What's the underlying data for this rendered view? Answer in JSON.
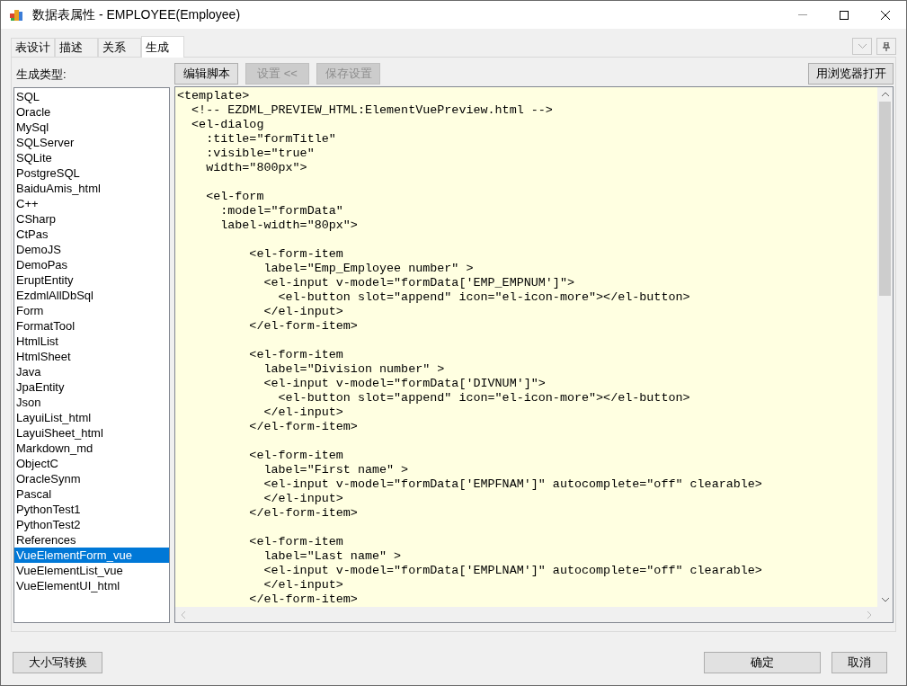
{
  "window": {
    "title": "数据表属性 - EMPLOYEE(Employee)"
  },
  "tabs": [
    {
      "label": "表设计",
      "selected": false
    },
    {
      "label": "描述",
      "selected": false
    },
    {
      "label": "关系",
      "selected": false
    },
    {
      "label": "生成",
      "selected": true
    }
  ],
  "sidebar": {
    "label": "生成类型:",
    "items": [
      {
        "label": "SQL",
        "selected": false
      },
      {
        "label": "Oracle",
        "selected": false
      },
      {
        "label": "MySql",
        "selected": false
      },
      {
        "label": "SQLServer",
        "selected": false
      },
      {
        "label": "SQLite",
        "selected": false
      },
      {
        "label": "PostgreSQL",
        "selected": false
      },
      {
        "label": "BaiduAmis_html",
        "selected": false
      },
      {
        "label": "C++",
        "selected": false
      },
      {
        "label": "CSharp",
        "selected": false
      },
      {
        "label": "CtPas",
        "selected": false
      },
      {
        "label": "DemoJS",
        "selected": false
      },
      {
        "label": "DemoPas",
        "selected": false
      },
      {
        "label": "EruptEntity",
        "selected": false
      },
      {
        "label": "EzdmlAllDbSql",
        "selected": false
      },
      {
        "label": "Form",
        "selected": false
      },
      {
        "label": "FormatTool",
        "selected": false
      },
      {
        "label": "HtmlList",
        "selected": false
      },
      {
        "label": "HtmlSheet",
        "selected": false
      },
      {
        "label": "Java",
        "selected": false
      },
      {
        "label": "JpaEntity",
        "selected": false
      },
      {
        "label": "Json",
        "selected": false
      },
      {
        "label": "LayuiList_html",
        "selected": false
      },
      {
        "label": "LayuiSheet_html",
        "selected": false
      },
      {
        "label": "Markdown_md",
        "selected": false
      },
      {
        "label": "ObjectC",
        "selected": false
      },
      {
        "label": "OracleSynm",
        "selected": false
      },
      {
        "label": "Pascal",
        "selected": false
      },
      {
        "label": "PythonTest1",
        "selected": false
      },
      {
        "label": "PythonTest2",
        "selected": false
      },
      {
        "label": "References",
        "selected": false
      },
      {
        "label": "VueElementForm_vue",
        "selected": true
      },
      {
        "label": "VueElementList_vue",
        "selected": false
      },
      {
        "label": "VueElementUI_html",
        "selected": false
      }
    ]
  },
  "toolbar": [
    {
      "label": "编辑脚本",
      "disabled": false
    },
    {
      "label": "设置 <<",
      "disabled": true
    },
    {
      "label": "保存设置",
      "disabled": true
    }
  ],
  "open_in_browser_button": "用浏览器打开",
  "editor": {
    "code": "<template>\n  <!-- EZDML_PREVIEW_HTML:ElementVuePreview.html -->\n  <el-dialog\n    :title=\"formTitle\"\n    :visible=\"true\"\n    width=\"800px\">\n\n    <el-form\n      :model=\"formData\"\n      label-width=\"80px\">\n\n          <el-form-item\n            label=\"Emp_Employee number\" >\n            <el-input v-model=\"formData['EMP_EMPNUM']\">\n              <el-button slot=\"append\" icon=\"el-icon-more\"></el-button>\n            </el-input>\n          </el-form-item>\n\n          <el-form-item\n            label=\"Division number\" >\n            <el-input v-model=\"formData['DIVNUM']\">\n              <el-button slot=\"append\" icon=\"el-icon-more\"></el-button>\n            </el-input>\n          </el-form-item>\n\n          <el-form-item\n            label=\"First name\" >\n            <el-input v-model=\"formData['EMPFNAM']\" autocomplete=\"off\" clearable>\n            </el-input>\n          </el-form-item>\n\n          <el-form-item\n            label=\"Last name\" >\n            <el-input v-model=\"formData['EMPLNAM']\" autocomplete=\"off\" clearable>\n            </el-input>\n          </el-form-item>"
  },
  "footer": {
    "left_button": "大小写转换",
    "buttons": [
      "确定",
      "取消"
    ]
  }
}
